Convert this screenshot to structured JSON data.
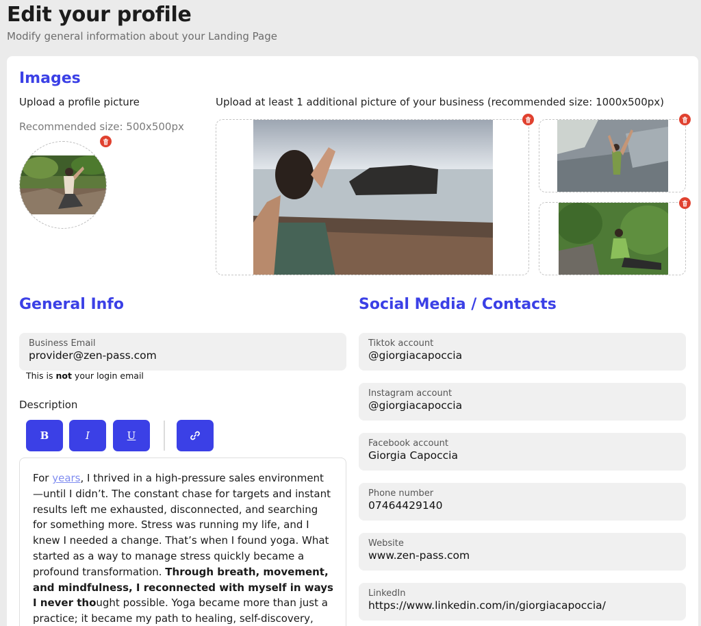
{
  "header": {
    "title": "Edit your profile",
    "subtitle": "Modify general information about your Landing Page"
  },
  "images": {
    "section_title": "Images",
    "profile_label": "Upload a profile picture",
    "profile_hint": "Recommended size: 500x500px",
    "business_label": "Upload at least 1 additional picture of your business (recommended size: 1000x500px)"
  },
  "general": {
    "section_title": "General Info",
    "email_label": "Business Email",
    "email_value": "provider@zen-pass.com",
    "email_note_pre": "This is ",
    "email_note_bold": "not",
    "email_note_post": " your login email",
    "description_label": "Description",
    "toolbar": {
      "bold": "B",
      "italic": "I",
      "underline": "U"
    },
    "description": {
      "p1": "For ",
      "link": "years",
      "p2": ", I thrived in a high-pressure sales environment—until I didn’t. The constant chase for targets and instant results left me exhausted, disconnected, and searching for something more. Stress was running my life, and I knew I needed a change. That’s when I found yoga. What started as a way to manage stress quickly became a profound transformation. ",
      "bold": "Through breath, movement, and mindfulness, I reconnected with myself in ways I never tho",
      "p3": "ught possible. Yoga became more than just a practice; it became my path to healing, self-discovery, and purpose."
    }
  },
  "social": {
    "section_title": "Social Media / Contacts",
    "fields": [
      {
        "label": "Tiktok account",
        "value": "@giorgiacapoccia"
      },
      {
        "label": "Instagram account",
        "value": "@giorgiacapoccia"
      },
      {
        "label": "Facebook account",
        "value": "Giorgia Capoccia"
      },
      {
        "label": "Phone number",
        "value": "07464429140"
      },
      {
        "label": "Website",
        "value": "www.zen-pass.com"
      },
      {
        "label": "LinkedIn",
        "value": "https://www.linkedin.com/in/giorgiacapoccia/"
      }
    ]
  },
  "icons": {
    "delete": "trash-icon",
    "bold": "bold-icon",
    "italic": "italic-icon",
    "underline": "underline-icon",
    "link": "link-icon"
  },
  "colors": {
    "accent": "#3b40e6",
    "danger": "#e0412f",
    "field_bg": "#f0f0f0",
    "page_bg": "#ebebeb"
  }
}
